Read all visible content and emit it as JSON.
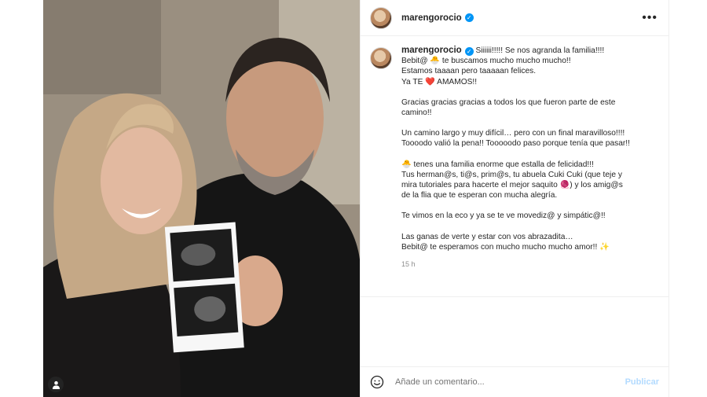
{
  "post": {
    "username": "marengorocio",
    "verified": true
  },
  "caption": {
    "paragraphs": [
      [
        "Siiiiii!!!!! Se nos agranda la familia!!!!",
        "Bebit@ 🐣 te buscamos mucho mucho mucho!!",
        "Estamos taaaan pero taaaaan felices.",
        "Ya TE ❤️ AMAMOS!!"
      ],
      [
        "Gracias gracias gracias a todos los que fueron parte de este",
        "camino!!"
      ],
      [
        "Un camino largo y muy difícil… pero con un final maravilloso!!!!",
        "Toooodo valió la pena!! Tooooodo paso porque tenía que pasar!!"
      ],
      [
        "🐣 tenes una familia enorme que estalla de felicidad!!!",
        "Tus herman@s, ti@s, prim@s, tu abuela Cuki Cuki (que teje y",
        "mira tutoriales para hacerte el mejor saquito 🧶) y los amig@s",
        "de la flia que te esperan con mucha alegría."
      ],
      [
        "Te vimos en la eco y ya se te ve movediz@ y simpátic@!!"
      ],
      [
        "Las ganas de verte y estar con vos abrazadita…",
        "Bebit@ te esperamos con mucho mucho mucho amor!! ✨"
      ]
    ],
    "time": "15 h"
  },
  "comment": {
    "placeholder": "Añade un comentario...",
    "publish_label": "Publicar"
  },
  "icons": {
    "more": "more-options-icon",
    "emoji": "emoji-smiley-icon",
    "tag": "user-tag-icon"
  },
  "colors": {
    "verified": "#0095f6",
    "publish_disabled": "#b3dbff",
    "heart": "#ed4956"
  }
}
